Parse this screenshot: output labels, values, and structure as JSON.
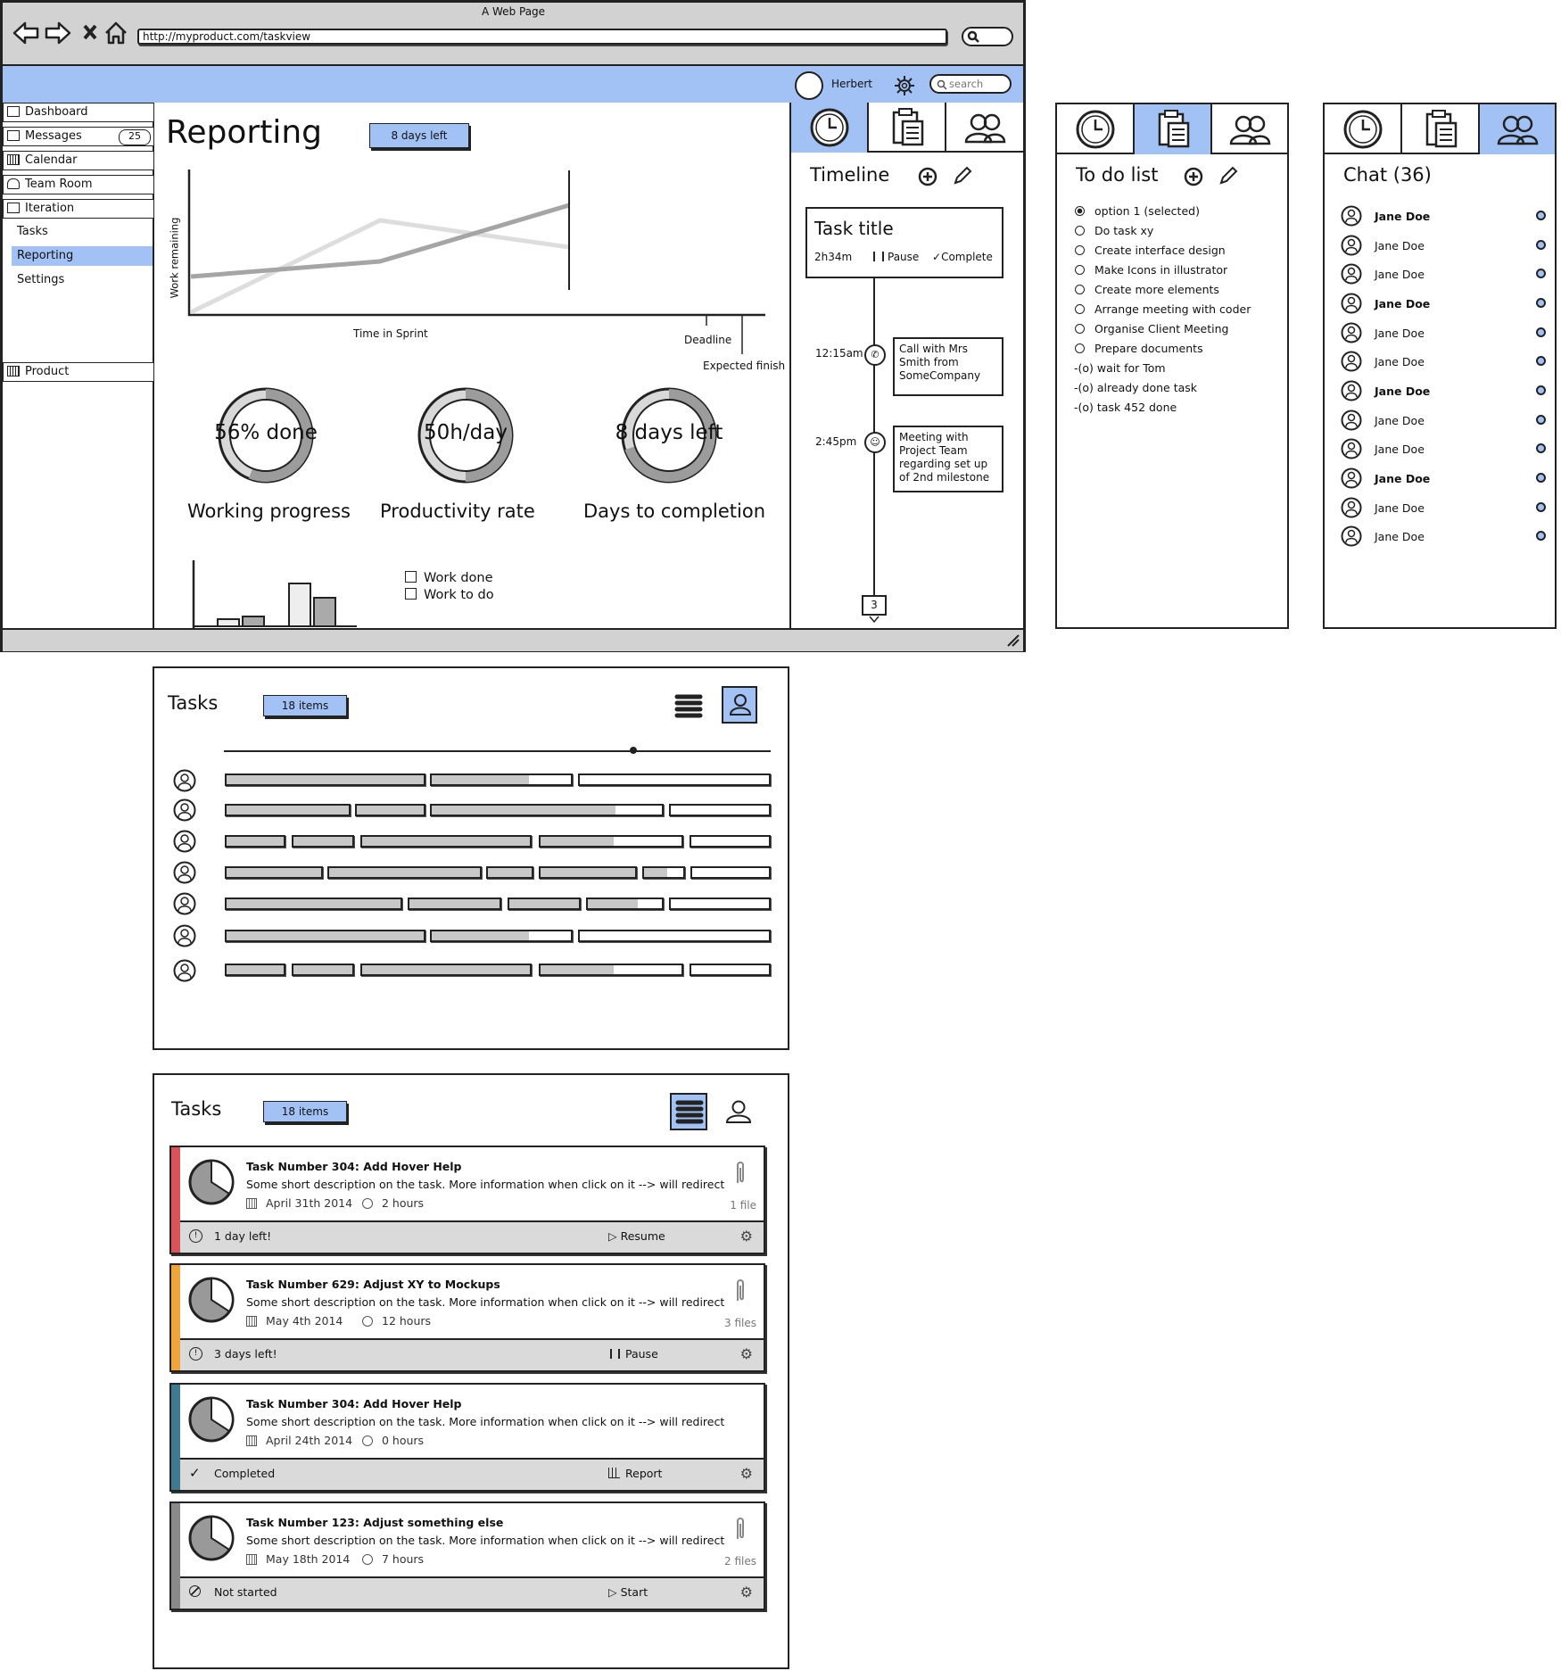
{
  "browser": {
    "title": "A Web Page",
    "url": "http://myproduct.com/taskview"
  },
  "header": {
    "user": "Herbert",
    "search_placeholder": "search"
  },
  "sidebar": {
    "items": [
      {
        "label": "Dashboard",
        "icon": "dashboard-icon"
      },
      {
        "label": "Messages",
        "icon": "envelope-icon",
        "badge": "25"
      },
      {
        "label": "Calendar",
        "icon": "calendar-icon"
      },
      {
        "label": "Team Room",
        "icon": "team-icon"
      },
      {
        "label": "Iteration",
        "icon": "iteration-icon"
      }
    ],
    "sub_items": [
      "Tasks",
      "Reporting",
      "Settings"
    ],
    "product": "Product"
  },
  "reporting": {
    "title": "Reporting",
    "days_left": "8 days left",
    "chart_labels": {
      "y": "Work remaining",
      "x": "Time in Sprint",
      "deadline": "Deadline",
      "expected": "Expected finish"
    },
    "gauges": [
      {
        "text": "56% done",
        "caption": "Working progress",
        "fraction": 0.56
      },
      {
        "text": "50h/day",
        "caption": "Productivity rate",
        "fraction": 0.5
      },
      {
        "text": "8 days left",
        "caption": "Days to completion",
        "fraction": 0.7
      }
    ],
    "legend": [
      "Work done",
      "Work to do"
    ]
  },
  "timeline": {
    "title": "Timeline",
    "task_title": "Task title",
    "duration": "2h34m",
    "pause": "Pause",
    "complete": "Complete",
    "events": [
      {
        "time": "12:15am",
        "text": "Call with Mrs Smith from SomeCompany"
      },
      {
        "time": "2:45pm",
        "text": "Meeting with Project Team regarding set up of 2nd milestone"
      }
    ],
    "end_marker": "3"
  },
  "todo": {
    "title": "To do list",
    "items": [
      "option 1 (selected)",
      "Do task xy",
      "Create interface design",
      "Make Icons in illustrator",
      "Create more elements",
      "Arrange meeting with coder",
      "Organise Client Meeting",
      "Prepare documents"
    ],
    "done": [
      "-(o) wait for Tom",
      "-(o) already done task",
      "-(o) task 452 done"
    ]
  },
  "chat": {
    "title": "Chat (36)",
    "users": [
      "Jane Doe",
      "Jane Doe",
      "Jane Doe",
      "Jane Doe",
      "Jane Doe",
      "Jane Doe",
      "Jane Doe",
      "Jane Doe",
      "Jane Doe",
      "Jane Doe",
      "Jane Doe",
      "Jane Doe"
    ]
  },
  "tasks_gantt": {
    "title": "Tasks",
    "count": "18 items"
  },
  "tasks_list": {
    "title": "Tasks",
    "count": "18 items",
    "cards": [
      {
        "title": "Task Number 304: Add Hover Help",
        "desc": "Some short description on the task. More information when click on it --> will redirect",
        "date": "April 31th 2014",
        "hours": "2 hours",
        "files": "1 file",
        "status": "1 day left!",
        "action": "Resume",
        "color": "#d9535a"
      },
      {
        "title": "Task Number 629: Adjust XY to Mockups",
        "desc": "Some short description on the task. More information when click on it --> will redirect",
        "date": "May 4th 2014",
        "hours": "12 hours",
        "files": "3 files",
        "status": "3 days left!",
        "action": "Pause",
        "color": "#f0a43c"
      },
      {
        "title": "Task Number 304: Add Hover Help",
        "desc": "Some short description on the task. More information when click on it --> will redirect",
        "date": "April 24th 2014",
        "hours": "0 hours",
        "files": "",
        "status": "Completed",
        "action": "Report",
        "color": "#3f7a8f"
      },
      {
        "title": "Task Number 123: Adjust something else",
        "desc": "Some short description on the task. More information when click on it --> will redirect",
        "date": "May 18th 2014",
        "hours": "7 hours",
        "files": "2 files",
        "status": "Not started",
        "action": "Start",
        "color": "#8a8a8a"
      }
    ]
  }
}
